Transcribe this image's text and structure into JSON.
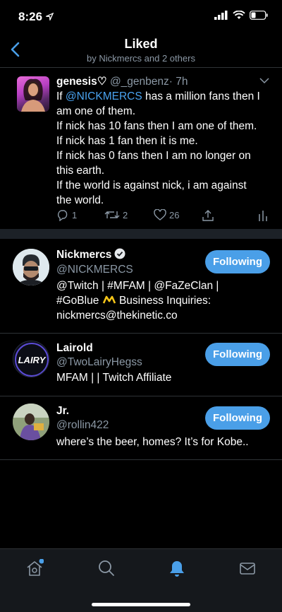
{
  "status": {
    "time": "8:26"
  },
  "header": {
    "title": "Liked",
    "subtitle": "by Nickmercs and 2 others"
  },
  "tweet": {
    "name": "genesis♡",
    "handle": "@_genbenz",
    "time": "· 7h",
    "text_prefix": "If ",
    "mention": "@NICKMERCS",
    "text_line1_suffix": " has a million fans then I",
    "lines": [
      "am one of them.",
      "If nick has 10 fans then I am one of them.",
      "If nick has 1 fan then it is me.",
      "If nick has 0 fans then I am no longer on",
      "this earth.",
      "If the world is against nick, i am against",
      "the world."
    ],
    "replies": "1",
    "retweets": "2",
    "likes": "26"
  },
  "users": [
    {
      "name": "Nickmercs",
      "handle": "@NICKMERCS",
      "bio_lines": [
        "@Twitch | #MFAM | @FaZeClan |",
        "#GoBlue",
        "Business Inquiries:",
        "nickmercs@thekinetic.co"
      ],
      "button": "Following"
    },
    {
      "name": "Lairold",
      "handle": "@TwoLairyHegss",
      "avatar_text": "LAIRY",
      "bio_lines": [
        "MFAM | | Twitch Affiliate"
      ],
      "button": "Following"
    },
    {
      "name": "Jr.",
      "handle": "@rollin422",
      "bio_lines": [
        "where’s the beer, homes? It’s for Kobe.."
      ],
      "button": "Following"
    }
  ],
  "tabs": [
    "home-icon",
    "search-icon",
    "notifications-icon",
    "messages-icon"
  ],
  "colors": {
    "accent": "#4a9fe8",
    "mention": "#4aa3f0",
    "muted": "#8b98a5"
  }
}
